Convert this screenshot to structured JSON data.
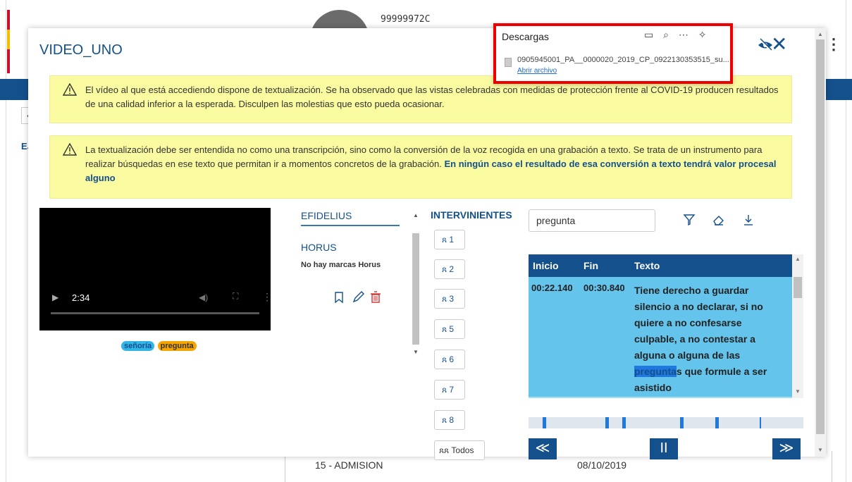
{
  "background": {
    "id_text": "99999972C",
    "left_tab": "EJ",
    "back_arrow": "‹",
    "bottom_left": "15 - ADMISION",
    "bottom_right": "08/10/2019",
    "kebab": "⋮"
  },
  "modal": {
    "title": "VIDEO_UNO",
    "close": "✕"
  },
  "warnings": {
    "w1": "El vídeo al que está accediendo dispone de textualización. Se ha observado que las vistas celebradas con medidas de protección frente al COVID-19 producen resultados de una calidad inferior a la esperada. Disculpen las molestias que esto pueda ocasionar.",
    "w2": "La textualización debe ser entendida no como una transcripción, sino como la conversión de la voz recogida en una grabación a texto. Se trata de un instrumento para realizar búsquedas en ese texto que permitan ir a momentos concretos de la grabación.",
    "w2_strong": "En ningún caso el resultado de esa conversión a texto tendrá valor procesal alguno"
  },
  "video": {
    "time": "2:34",
    "tags": [
      "señoría",
      "pregunta"
    ]
  },
  "efidelius": {
    "header": "EFIDELIUS",
    "horus": "HORUS",
    "no_marks": "No hay marcas Horus"
  },
  "intervinientes": {
    "header": "INTERVINIENTES",
    "items": [
      "1",
      "2",
      "3",
      "5",
      "6",
      "7",
      "8"
    ],
    "todos": "Todos"
  },
  "search": {
    "value": "pregunta"
  },
  "table": {
    "headers": [
      "Inicio",
      "Fin",
      "Texto"
    ],
    "row": {
      "inicio": "00:22.140",
      "fin": "00:30.840",
      "text_before": "Tiene derecho a guardar silencio a no declarar, si no quiere a no confesarse culpable, a no contestar a alguna o alguna de las ",
      "text_highlight": "pregunta",
      "text_after": "s que formule a ser asistido"
    }
  },
  "timeline": {
    "marks": [
      0.05,
      0.28,
      0.34,
      0.55,
      0.68,
      0.84
    ]
  },
  "nav": {
    "prev": "≪",
    "pause": "II",
    "next": "≫"
  },
  "downloads": {
    "title": "Descargas",
    "file": "0905945001_PA__0000020_2019_CP_0922130353515_su...",
    "open": "Abrir archivo"
  },
  "colors": {
    "brand_blue": "#14508c",
    "warning_bg": "#fafaa0",
    "highlight_red": "#e00000"
  }
}
